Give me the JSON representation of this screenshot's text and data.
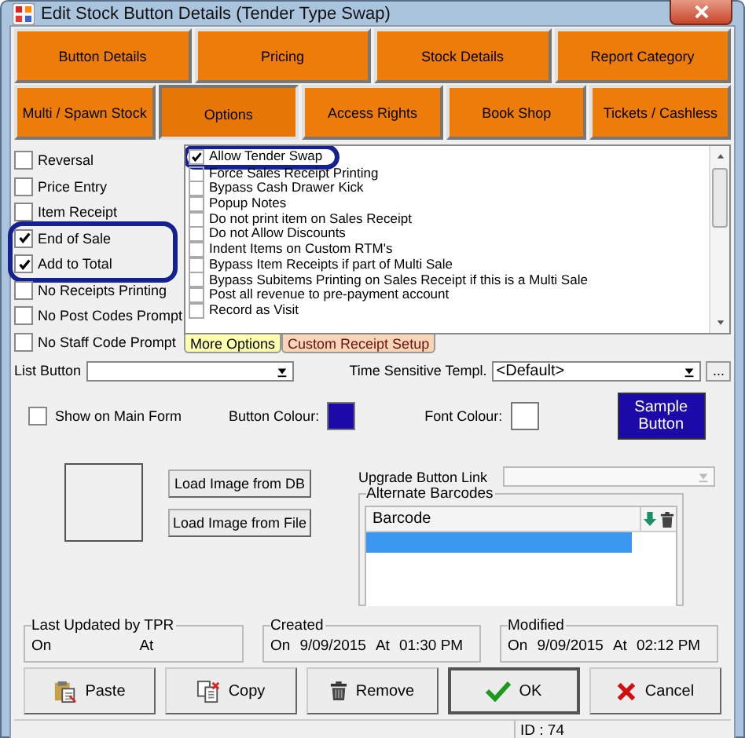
{
  "window": {
    "title": "Edit Stock Button Details (Tender Type Swap)"
  },
  "tab_rows": [
    [
      {
        "label": "Button Details",
        "selected": false
      },
      {
        "label": "Pricing",
        "selected": false
      },
      {
        "label": "Stock Details",
        "selected": false
      },
      {
        "label": "Report Category",
        "selected": false
      }
    ],
    [
      {
        "label": "Multi / Spawn Stock",
        "selected": false
      },
      {
        "label": "Options",
        "selected": true
      },
      {
        "label": "Access Rights",
        "selected": false
      },
      {
        "label": "Book Shop",
        "selected": false
      },
      {
        "label": "Tickets / Cashless",
        "selected": false
      }
    ]
  ],
  "left_options": [
    {
      "label": "Reversal",
      "checked": false,
      "highlighted": false
    },
    {
      "label": "Price Entry",
      "checked": false,
      "highlighted": false
    },
    {
      "label": "Item Receipt",
      "checked": false,
      "highlighted": false
    },
    {
      "label": "End of Sale",
      "checked": true,
      "highlighted": true
    },
    {
      "label": "Add to Total",
      "checked": true,
      "highlighted": true
    },
    {
      "label": "No Receipts Printing",
      "checked": false,
      "highlighted": false
    },
    {
      "label": "No Post Codes Prompt",
      "checked": false,
      "highlighted": false
    },
    {
      "label": "No Staff Code Prompt",
      "checked": false,
      "highlighted": false
    }
  ],
  "more_options": [
    {
      "label": "Allow Tender Swap",
      "checked": true,
      "highlighted": true
    },
    {
      "label": "Force Sales Receipt Printing",
      "checked": false,
      "highlighted": false
    },
    {
      "label": "Bypass Cash Drawer Kick",
      "checked": false,
      "highlighted": false
    },
    {
      "label": "Popup Notes",
      "checked": false,
      "highlighted": false
    },
    {
      "label": "Do not print item on Sales Receipt",
      "checked": false,
      "highlighted": false
    },
    {
      "label": "Do not Allow Discounts",
      "checked": false,
      "highlighted": false
    },
    {
      "label": "Indent Items on Custom RTM's",
      "checked": false,
      "highlighted": false
    },
    {
      "label": "Bypass Item Receipts if part of Multi Sale",
      "checked": false,
      "highlighted": false
    },
    {
      "label": "Bypass Subitems Printing on Sales Receipt if this is a Multi Sale",
      "checked": false,
      "highlighted": false
    },
    {
      "label": "Post all revenue to pre-payment account",
      "checked": false,
      "highlighted": false
    },
    {
      "label": "Record as Visit",
      "checked": false,
      "highlighted": false
    }
  ],
  "option_tabs": [
    {
      "label": "More Options",
      "selected": true
    },
    {
      "label": "Custom Receipt Setup",
      "selected": false
    }
  ],
  "list_button": {
    "label": "List Button"
  },
  "time_sensitive": {
    "label": "Time Sensitive Templ.",
    "value": "<Default>",
    "more": "..."
  },
  "show_on_main_form": {
    "label": "Show on Main Form",
    "checked": false
  },
  "button_colour": {
    "label": "Button Colour:",
    "color": "#1c0aa8"
  },
  "font_colour": {
    "label": "Font Colour:",
    "color": "#ffffff"
  },
  "sample_button": {
    "label": "Sample Button"
  },
  "load_buttons": [
    "Load Image from DB",
    "Load Image from File"
  ],
  "upgrade_link": {
    "label": "Upgrade Button Link",
    "disabled": true
  },
  "alternate_barcodes": {
    "title": "Alternate Barcodes",
    "columns": [
      "Barcode"
    ],
    "rows": [
      {
        "selected": true
      }
    ]
  },
  "audit": [
    {
      "title": "Last Updated by TPR",
      "on_label": "On",
      "at_label": "At"
    },
    {
      "title": "Created",
      "on_label": "On",
      "date": "9/09/2015",
      "at_label": "At",
      "time": "01:30 PM"
    },
    {
      "title": "Modified",
      "on_label": "On",
      "date": "9/09/2015",
      "at_label": "At",
      "time": "02:12 PM"
    }
  ],
  "actions": [
    {
      "label": "Paste",
      "kind": "paste",
      "default": false
    },
    {
      "label": "Copy",
      "kind": "copy",
      "default": false
    },
    {
      "label": "Remove",
      "kind": "remove",
      "default": false
    },
    {
      "label": "OK",
      "kind": "ok",
      "default": true
    },
    {
      "label": "Cancel",
      "kind": "cancel",
      "default": false
    }
  ],
  "status_bar": {
    "id": "ID : 74"
  }
}
